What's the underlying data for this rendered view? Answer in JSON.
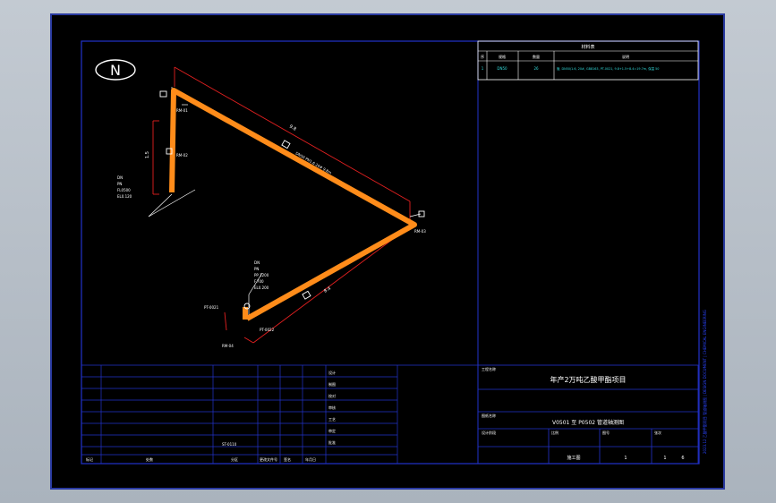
{
  "north_marker": {
    "label": "N"
  },
  "piping": {
    "dims": {
      "top_run": "9.8",
      "left_riser": "1.5",
      "lower_run": "8.4"
    },
    "labels": {
      "nodes": [
        "RM-01",
        "RM-02",
        "RM-03",
        "RM-04"
      ],
      "left_note": [
        "DN",
        "PN",
        "FL0500",
        "EL0.120"
      ],
      "lower_note": [
        "DN",
        "PN",
        "PP 1200",
        "F.700",
        "EL0.200"
      ],
      "left_pt": "PT-0021",
      "under_pt": "PT-0022",
      "top_run_note": "DN50 PN1.6 20# 9.8m",
      "side_small": "1.5"
    }
  },
  "material_table": {
    "title": "材料表",
    "headers": [
      "序",
      "规格",
      "数量",
      "说明"
    ],
    "row": [
      "1",
      "DN50",
      "26",
      "管, DN50/1.6, 20#, GB8163, PT-0021, 9.8+1.5+8.4=19.7m, 保温 50"
    ]
  },
  "title_block": {
    "project_caption": "工程名称",
    "project_name": "年产2万吨乙酸甲酯项目",
    "drawing_caption": "图纸名称",
    "drawing_name": "V0501 至 P0502 管道轴测图",
    "left_code": "ST-0110",
    "footer_left": [
      "标记",
      "处数",
      "分区",
      "更改文件号",
      "签名",
      "年月日"
    ],
    "sign_rows": [
      "设计",
      "制图",
      "校对",
      "审核",
      "工艺",
      "审定",
      "批准"
    ],
    "cell_labels": [
      "设计阶段",
      "比例",
      "图号",
      "张次"
    ],
    "sheet_info": [
      "施工图",
      "1",
      "1",
      "6"
    ],
    "side_text": "2023.12 乙酸甲酯项目 管道轴测图 | DESIGN DOCUMENT | CHEMICAL ENGINEERING"
  },
  "colors": {
    "pipe": "#ff8c1a",
    "frame": "#2233cc",
    "red": "#e52020",
    "text": "#ffffff",
    "cyan": "#33dddd"
  }
}
